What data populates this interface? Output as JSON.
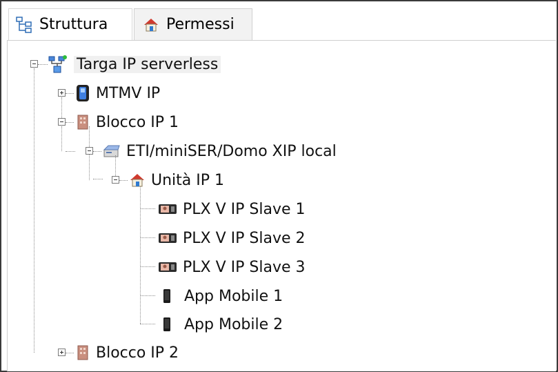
{
  "tabs": [
    {
      "label": "Struttura",
      "icon": "structure-icon",
      "active": true
    },
    {
      "label": "Permessi",
      "icon": "permissions-house-icon",
      "active": false
    }
  ],
  "tree": {
    "root": {
      "label": "Targa IP serverless",
      "icon": "network-server-icon",
      "expanded": true
    },
    "mtmv": {
      "label": "MTMV IP",
      "icon": "device-panel-icon",
      "expanded": false
    },
    "blocco1": {
      "label": "Blocco IP 1",
      "icon": "building-icon",
      "expanded": true
    },
    "eti": {
      "label": "ETI/miniSER/Domo XIP local",
      "icon": "server-icon",
      "expanded": true
    },
    "unita": {
      "label": "Unità IP 1",
      "icon": "house-icon",
      "expanded": true
    },
    "slave1": {
      "label": "PLX V IP Slave 1",
      "icon": "monitor-icon"
    },
    "slave2": {
      "label": "PLX V IP Slave 2",
      "icon": "monitor-icon"
    },
    "slave3": {
      "label": "PLX V IP Slave 3",
      "icon": "monitor-icon"
    },
    "app1": {
      "label": "App Mobile 1",
      "icon": "phone-icon"
    },
    "app2": {
      "label": "App Mobile 2",
      "icon": "phone-icon"
    },
    "blocco2": {
      "label": "Blocco IP 2",
      "icon": "building-icon",
      "expanded": false
    }
  }
}
